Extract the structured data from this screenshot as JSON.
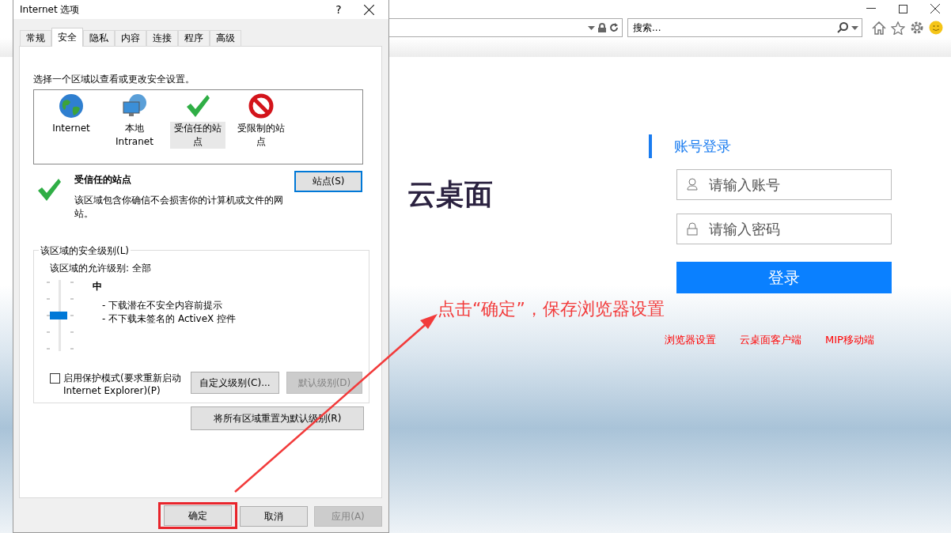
{
  "browser": {
    "search": {
      "placeholder": "搜索..."
    }
  },
  "login": {
    "brand": "云桌面",
    "heading": "账号登录",
    "username": {
      "placeholder": "请输入账号"
    },
    "password": {
      "placeholder": "请输入密码"
    },
    "submit": "登录",
    "links": [
      "浏览器设置",
      "云桌面客户端",
      "MIP移动端"
    ]
  },
  "annotation": {
    "text": "点击“确定”，保存浏览器设置"
  },
  "dialog": {
    "title": "Internet 选项",
    "help": "?",
    "tabs": [
      {
        "label": "常规",
        "selected": false
      },
      {
        "label": "安全",
        "selected": true
      },
      {
        "label": "隐私",
        "selected": false
      },
      {
        "label": "内容",
        "selected": false
      },
      {
        "label": "连接",
        "selected": false
      },
      {
        "label": "程序",
        "selected": false
      },
      {
        "label": "高级",
        "selected": false
      }
    ],
    "prompt": "选择一个区域以查看或更改安全设置。",
    "zones": [
      {
        "label": "Internet",
        "kind": "globe",
        "selected": false
      },
      {
        "label": "本地 Intranet",
        "kind": "intranet",
        "selected": false
      },
      {
        "label": "受信任的站点",
        "kind": "trusted",
        "selected": true
      },
      {
        "label": "受限制的站点",
        "kind": "restricted",
        "selected": false
      }
    ],
    "zone_info": {
      "title": "受信任的站点",
      "description": "该区域包含你确信不会损害你的计算机或文件的网站。",
      "sites_button": {
        "label": "站点(S)",
        "focused": true
      }
    },
    "security_level": {
      "legend": "该区域的安全级别(L)",
      "allowed": "该区域的允许级别: 全部",
      "level": 0.5,
      "level_name": "中",
      "bullets": [
        "- 下载潜在不安全内容前提示",
        "- 不下载未签名的 ActiveX 控件"
      ],
      "protected_mode": {
        "label": "启用保护模式(要求重新启动 Internet Explorer)(P)",
        "checked": false
      },
      "custom_button": {
        "label": "自定义级别(C)...",
        "disabled": false
      },
      "default_button": {
        "label": "默认级别(D)",
        "disabled": true
      }
    },
    "reset_button": "将所有区域重置为默认级别(R)",
    "footer_buttons": [
      {
        "label": "确定",
        "disabled": false,
        "highlighted": true
      },
      {
        "label": "取消",
        "disabled": false,
        "highlighted": false
      },
      {
        "label": "应用(A)",
        "disabled": true,
        "highlighted": false
      }
    ]
  }
}
